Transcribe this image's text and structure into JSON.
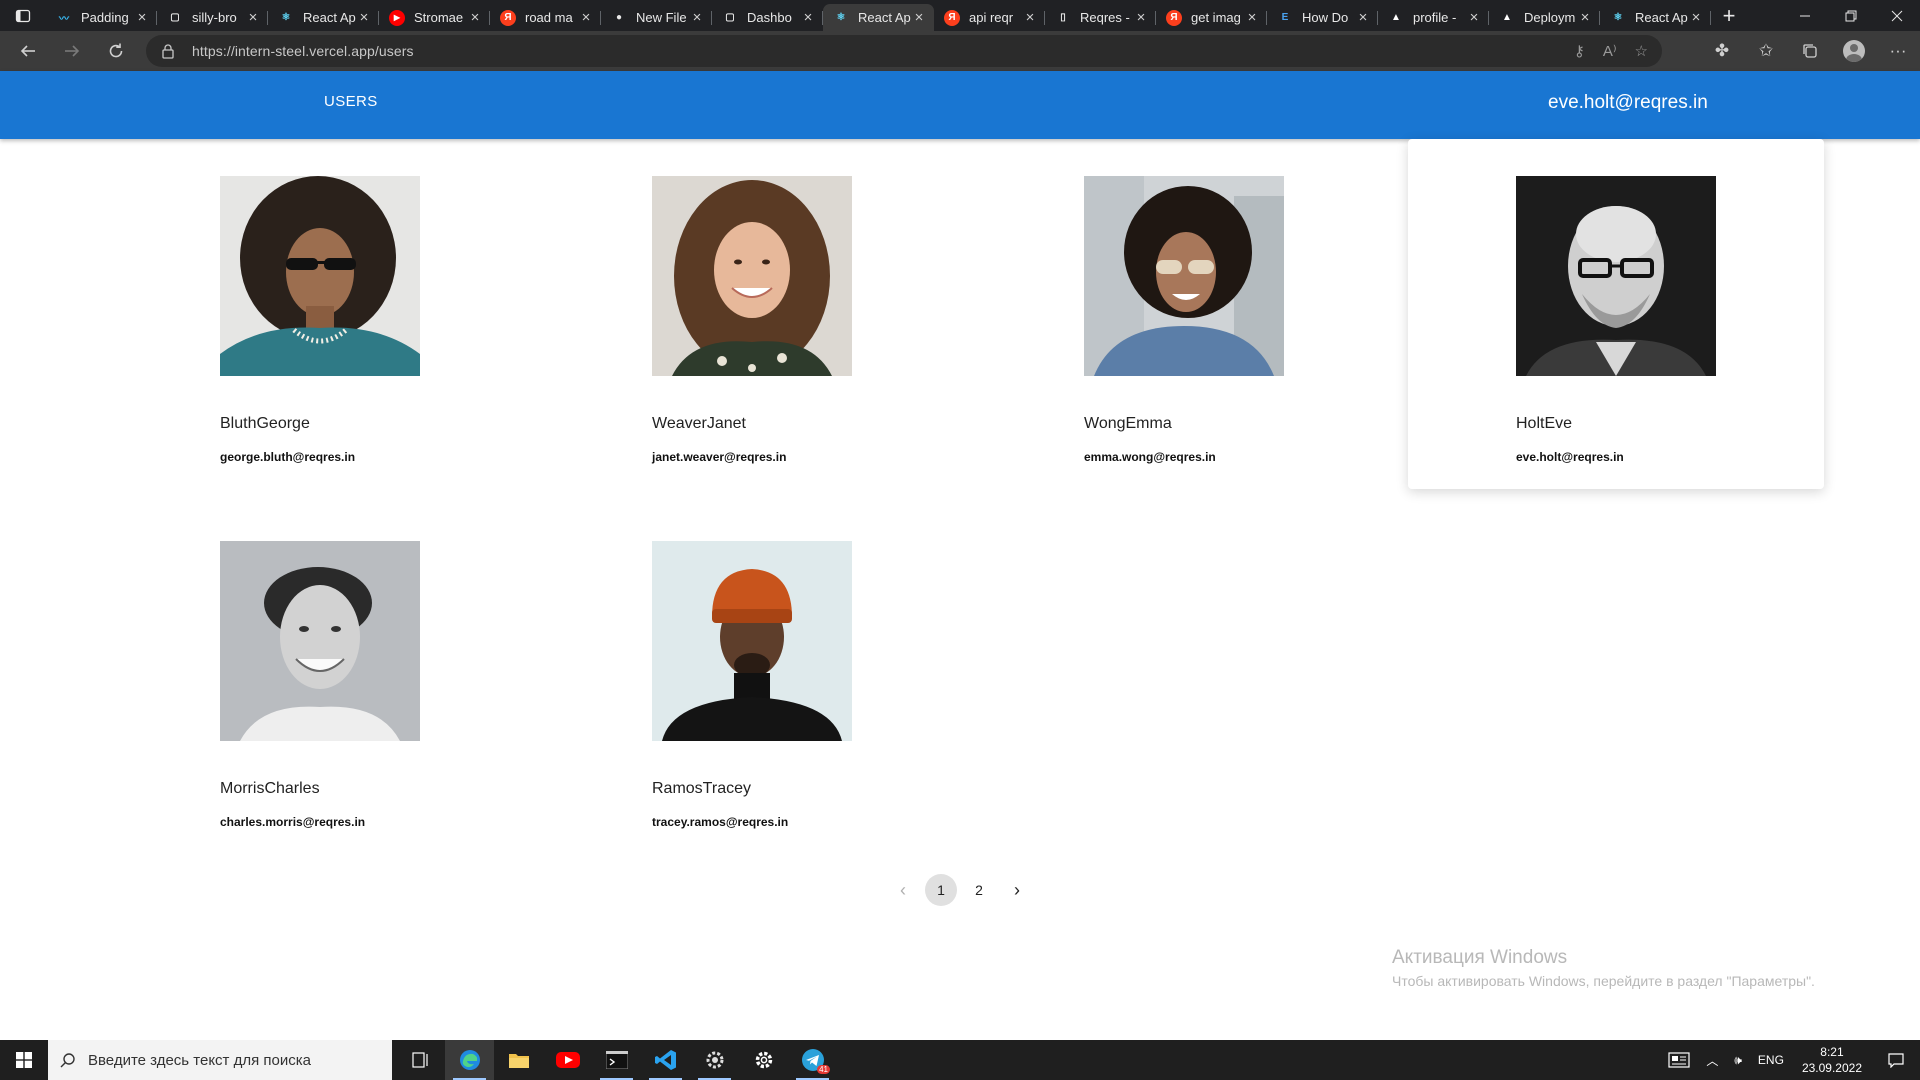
{
  "browser": {
    "tabs": [
      {
        "title": "Padding",
        "icon": "wave-icon",
        "color": "#38bdf8",
        "active": false
      },
      {
        "title": "silly-bro",
        "icon": "codesandbox-icon",
        "color": "#e8e8e8",
        "active": false
      },
      {
        "title": "React Ap",
        "icon": "react-icon",
        "color": "#61dafb",
        "active": false
      },
      {
        "title": "Stromae",
        "icon": "youtube-icon",
        "color": "#ff0000",
        "active": false
      },
      {
        "title": "road ma",
        "icon": "yandex-icon",
        "color": "#fc3f1d",
        "active": false
      },
      {
        "title": "New File",
        "icon": "github-icon",
        "color": "#e8e8e8",
        "active": false
      },
      {
        "title": "Dashbo",
        "icon": "codesandbox-icon",
        "color": "#e8e8e8",
        "active": false
      },
      {
        "title": "React Ap",
        "icon": "react-icon",
        "color": "#61dafb",
        "active": true
      },
      {
        "title": "api reqr",
        "icon": "yandex-icon",
        "color": "#fc3f1d",
        "active": false
      },
      {
        "title": "Reqres -",
        "icon": "page-icon",
        "color": "#e8e8e8",
        "active": false
      },
      {
        "title": "get imag",
        "icon": "yandex-icon",
        "color": "#fc3f1d",
        "active": false
      },
      {
        "title": "How Do",
        "icon": "edge-doc-icon",
        "color": "#4aa3f0",
        "active": false
      },
      {
        "title": "profile -",
        "icon": "vercel-icon",
        "color": "#ffffff",
        "active": false
      },
      {
        "title": "Deploym",
        "icon": "vercel-icon",
        "color": "#ffffff",
        "active": false
      },
      {
        "title": "React Ap",
        "icon": "react-icon",
        "color": "#61dafb",
        "active": false
      }
    ],
    "url": "https://intern-steel.vercel.app/users"
  },
  "app": {
    "nav_users": "USERS",
    "current_user_email": "eve.holt@reqres.in",
    "accent": "#1976d2"
  },
  "users": [
    {
      "name": "BluthGeorge",
      "email": "george.bluth@reqres.in"
    },
    {
      "name": "WeaverJanet",
      "email": "janet.weaver@reqres.in"
    },
    {
      "name": "WongEmma",
      "email": "emma.wong@reqres.in"
    },
    {
      "name": "HoltEve",
      "email": "eve.holt@reqres.in"
    },
    {
      "name": "MorrisCharles",
      "email": "charles.morris@reqres.in"
    },
    {
      "name": "RamosTracey",
      "email": "tracey.ramos@reqres.in"
    }
  ],
  "pagination": {
    "pages": [
      "1",
      "2"
    ],
    "current": "1"
  },
  "watermark": {
    "title": "Активация Windows",
    "subtitle": "Чтобы активировать Windows, перейдите в раздел \"Параметры\"."
  },
  "taskbar": {
    "search_placeholder": "Введите здесь текст для поиска",
    "language": "ENG",
    "time": "8:21",
    "date": "23.09.2022",
    "telegram_badge": "41"
  }
}
